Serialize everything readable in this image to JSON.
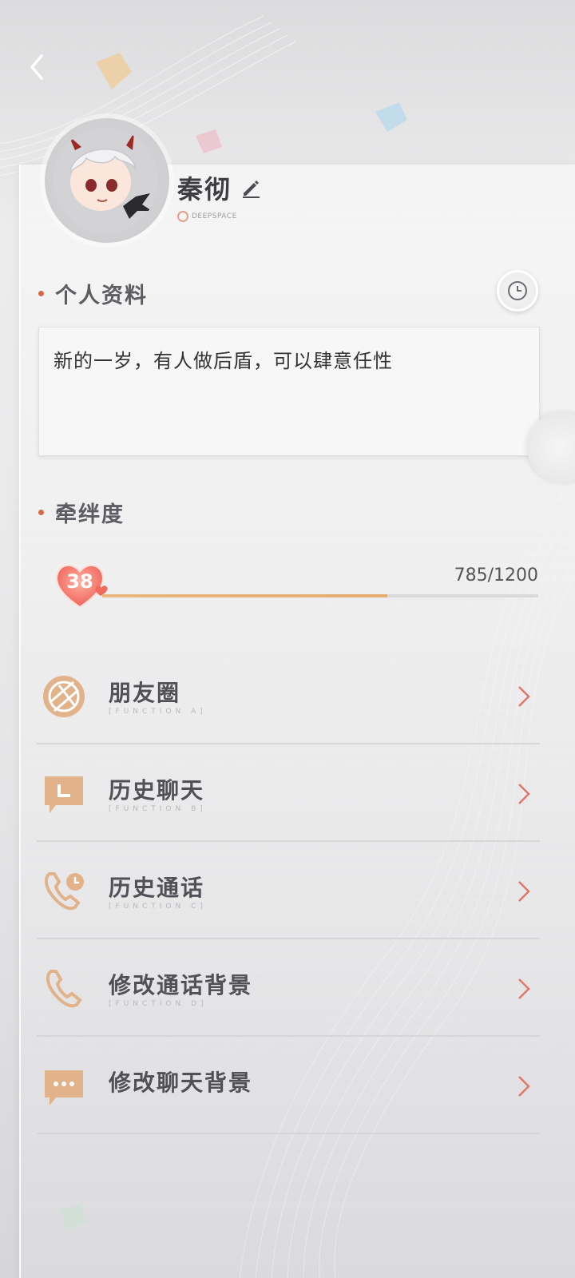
{
  "profile": {
    "name": "秦彻",
    "brand": "DEEPSPACE"
  },
  "sections": {
    "profile_title": "个人资料",
    "bond_title": "牵绊度"
  },
  "bio": {
    "text": "新的一岁，有人做后盾，可以肆意任性"
  },
  "bond": {
    "level": "38",
    "count_text": "785/1200",
    "current": 785,
    "max": 1200
  },
  "menu": {
    "items": [
      {
        "label": "朋友圈",
        "sub": "[FUNCTION A]",
        "icon": "moments-icon"
      },
      {
        "label": "历史聊天",
        "sub": "[FUNCTION B]",
        "icon": "chat-history-icon"
      },
      {
        "label": "历史通话",
        "sub": "[FUNCTION C]",
        "icon": "call-history-icon"
      },
      {
        "label": "修改通话背景",
        "sub": "[FUNCTION D]",
        "icon": "phone-icon"
      },
      {
        "label": "修改聊天背景",
        "sub": "",
        "icon": "chat-bubble-icon"
      }
    ]
  },
  "colors": {
    "accent": "#d4694a",
    "bar_fill": "#e6ad6f",
    "icon_tan": "#e2b38a",
    "chevron": "#e0776a"
  }
}
